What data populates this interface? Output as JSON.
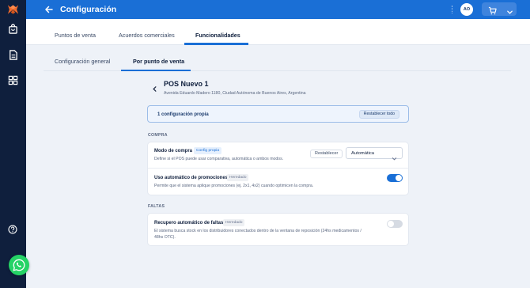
{
  "app": {
    "title": "Configuración",
    "user_initials": "AO"
  },
  "colors": {
    "primary": "#1a6fd6",
    "sidebar": "#0f1f3d",
    "brand_logo": "#f06a2c",
    "whatsapp": "#25d366"
  },
  "sidebar": {
    "icons": [
      "brand-logo",
      "shopping-bag-icon",
      "document-icon",
      "grid-icon",
      "help-icon"
    ]
  },
  "tabs": [
    {
      "label": "Puntos de venta",
      "active": false
    },
    {
      "label": "Acuerdos comerciales",
      "active": false
    },
    {
      "label": "Funcionalidades",
      "active": true
    }
  ],
  "subtabs": [
    {
      "label": "Configuración general",
      "active": false
    },
    {
      "label": "Por punto de venta",
      "active": true
    }
  ],
  "pos": {
    "name": "POS Nuevo 1",
    "address": "Avenida Eduardo Madero 1180, Ciudad Autónoma de Buenos Aires, Argentina"
  },
  "summary": {
    "text": "1 configuración propia",
    "restore_all": "Restablecer todo"
  },
  "sections": {
    "compra": {
      "label": "COMPRA",
      "rows": [
        {
          "title": "Modo de compra",
          "badge": "Config propia",
          "description": "Define si el POS puede usar comparativa, automática o ambos modos.",
          "restore_label": "Restablecer",
          "select_value": "Automática"
        },
        {
          "title": "Uso automático de promociones",
          "badge": "Heredado",
          "description": "Permite que el sistema aplique promociones (ej. 2x1, 4x2) cuando optimicen la compra.",
          "toggle_on": true
        }
      ]
    },
    "faltas": {
      "label": "FALTAS",
      "rows": [
        {
          "title": "Recupero automático de faltas",
          "badge": "Heredado",
          "description_line1": "El sistema busca stock en los distribuidores conectados dentro de la ventana de reposición (24hs medicamentos /",
          "description_line2": "48hs OTC).",
          "toggle_on": false
        }
      ]
    }
  }
}
